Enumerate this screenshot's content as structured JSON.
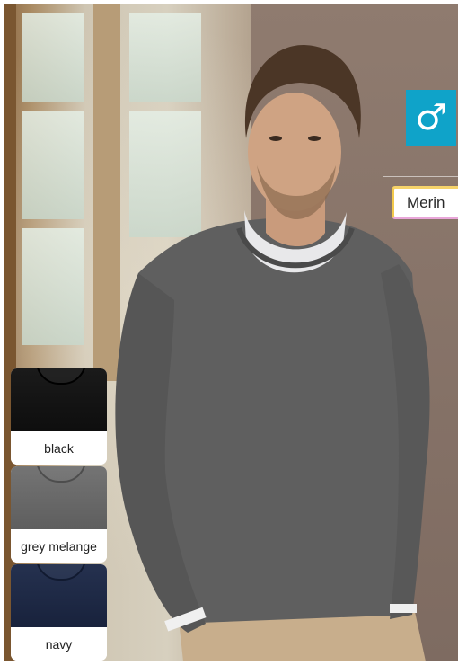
{
  "colors": {
    "male_badge": "#0fa3c9",
    "sweater": "#5f5f5f",
    "swatch_black": "#141414",
    "swatch_grey": "#6a6a6a",
    "swatch_navy": "#1e2a48"
  },
  "badge": {
    "gender_symbol": "♂",
    "icon": "male-symbol-icon"
  },
  "tag": {
    "label": "Merin"
  },
  "swatches": [
    {
      "label": "black"
    },
    {
      "label": "grey melange"
    },
    {
      "label": "navy"
    }
  ]
}
